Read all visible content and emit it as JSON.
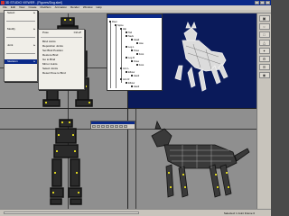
{
  "window": {
    "title": "3D STUDIO VIEWER - [Figures/Dog.skel]"
  },
  "menubar": {
    "items": [
      "File",
      "Edit",
      "View",
      "Create",
      "Modifiers",
      "Animation",
      "Render",
      "Window",
      "Help"
    ]
  },
  "file_menu": {
    "items": [
      {
        "label": "Select",
        "arrow": "▸"
      },
      {
        "label": "Modify",
        "arrow": "▸"
      },
      {
        "label": "Joint",
        "arrow": "▸"
      },
      {
        "label": "Skeleton",
        "arrow": "▸"
      }
    ]
  },
  "submenu": {
    "items": [
      {
        "label": "Pose",
        "shortcut": "Ctrl+P"
      },
      {
        "label": "Bind Joints",
        "shortcut": ""
      },
      {
        "label": "Reposition Joints",
        "shortcut": ""
      },
      {
        "label": "Set Bind Position",
        "shortcut": ""
      },
      {
        "label": "Restore Bind",
        "shortcut": ""
      },
      {
        "label": "Go to Bind",
        "shortcut": ""
      },
      {
        "label": "Mirror Joints",
        "shortcut": ""
      },
      {
        "label": "Select Joints",
        "shortcut": ""
      },
      {
        "label": "Reset Pose to Bind",
        "shortcut": ""
      }
    ]
  },
  "tree": {
    "nodes": [
      "Root",
      "Spine",
      "Hip",
      "Tail",
      "Neck",
      "Head",
      "Jaw",
      "Leg L",
      "Knee",
      "Foot",
      "Leg R",
      "Knee",
      "Foot",
      "Arm L",
      "Elbow",
      "Hand",
      "Arm R",
      "Elbow",
      "Hand",
      "Paw",
      "Toe",
      "End"
    ]
  },
  "status": {
    "text": "Selected: 1 Joint  Frame 0"
  },
  "right_panel": {
    "buttons": [
      "▣",
      "○",
      "□",
      "△",
      "✦",
      "⚙",
      "☰",
      "◉"
    ]
  }
}
